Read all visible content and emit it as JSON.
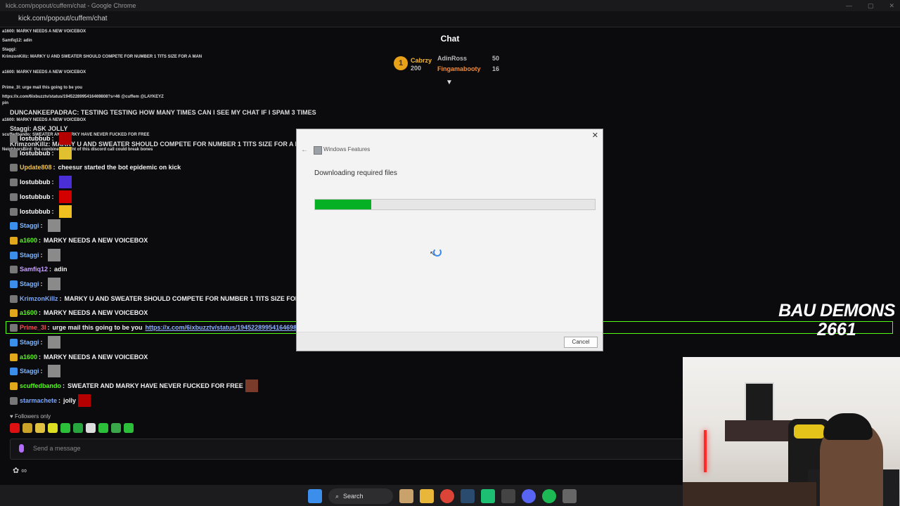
{
  "browser": {
    "title": "kick.com/popout/cuffem/chat - Google Chrome",
    "url": "kick.com/popout/cuffem/chat"
  },
  "chat": {
    "header": "Chat",
    "leaderboard": {
      "rank": "1",
      "first_name": "Cabrzy",
      "first_points": "200",
      "second_name": "AdinRoss",
      "second_points": "50",
      "third_name": "Fingamabooty",
      "third_points": "16"
    },
    "mini_messages": [
      "a1600: MARKY NEEDS A NEW VOICEBOX",
      "Samfiq12: adin",
      "Staggi:",
      "KrimzonKillz: MARKY U AND SWEATER SHOULD COMPETE FOR NUMBER 1 TITS SIZE FOR A MAN",
      "a1600: MARKY NEEDS A NEW VOICEBOX",
      "Prime_3l: urge mail this going to be you",
      "https://x.com/6ixbuzztv/status/1945228995416469808?s=46 @cuffem @LAYKEYZ",
      "pin",
      "DUNCANKEEPADRAC: TESTING TESTING HOW MANY TIMES CAN I SEE MY CHAT IF I SPAM 3 TIMES",
      "a1600: MARKY NEEDS A NEW VOICEBOX",
      "Staggi: ASK JOLLY",
      "scuffedbando: SWEATER AND MARKY HAVE NEVER FUCKED FOR FREE",
      "KrimzonKillz: MARKY U AND SWEATER SHOULD COMPETE FOR NUMBER 1 TITS SIZE FOR A MAN",
      "NeighborsBird: the combined weight of this discord call could break bones"
    ],
    "messages": [
      {
        "user": "lostubbub",
        "text": "",
        "ucolor": "#ffffff"
      },
      {
        "user": "lostubbub",
        "text": "",
        "ucolor": "#ffffff"
      },
      {
        "user": "Update808",
        "text": "cheesur started the bot epidemic on kick",
        "ucolor": "#f0c24b"
      },
      {
        "user": "lostubbub",
        "text": "",
        "ucolor": "#ffffff"
      },
      {
        "user": "lostubbub",
        "text": "",
        "ucolor": "#ffffff"
      },
      {
        "user": "lostubbub",
        "text": "",
        "ucolor": "#ffffff"
      },
      {
        "user": "Staggi",
        "text": "",
        "ucolor": "#7fb7ff"
      },
      {
        "user": "a1600",
        "text": "MARKY NEEDS A NEW VOICEBOX",
        "ucolor": "#53fc18"
      },
      {
        "user": "Staggi",
        "text": "",
        "ucolor": "#7fb7ff"
      },
      {
        "user": "Samfiq12",
        "text": "adin",
        "ucolor": "#c7a1ff"
      },
      {
        "user": "Staggi",
        "text": "",
        "ucolor": "#7fb7ff"
      },
      {
        "user": "KrimzonKillz",
        "text": "MARKY U AND SWEATER SHOULD COMPETE FOR NUMBER 1 TITS SIZE FOR A M",
        "ucolor": "#7aa8ff"
      },
      {
        "user": "a1600",
        "text": "MARKY NEEDS A NEW VOICEBOX",
        "ucolor": "#53fc18"
      },
      {
        "user": "Prime_3l",
        "text": "urge mail this going to be you",
        "link": "https://x.com/6ixbuzztv/status/194522899541646980",
        "ucolor": "#ff4d4d"
      },
      {
        "user": "Staggi",
        "text": "",
        "ucolor": "#7fb7ff"
      },
      {
        "user": "a1600",
        "text": "MARKY NEEDS A NEW VOICEBOX",
        "ucolor": "#53fc18"
      },
      {
        "user": "Staggi",
        "text": "",
        "ucolor": "#7fb7ff"
      },
      {
        "user": "scuffedbando",
        "text": "SWEATER AND MARKY HAVE NEVER FUCKED FOR FREE",
        "ucolor": "#53fc18"
      },
      {
        "user": "starmachete",
        "text": "jolly",
        "ucolor": "#7aa8ff"
      }
    ],
    "followers_only": "Followers only",
    "send_placeholder": "Send a message"
  },
  "dialog": {
    "title": "Windows Features",
    "heading": "Downloading required files",
    "progress": 0.2,
    "cancel_label": "Cancel",
    "close_label": "✕"
  },
  "overlay": {
    "line1": "BAU DEMONS",
    "line2": "2661"
  },
  "taskbar": {
    "search_label": "Search"
  },
  "colors": {
    "kick_green": "#53fc18",
    "progress_green": "#06b025"
  }
}
